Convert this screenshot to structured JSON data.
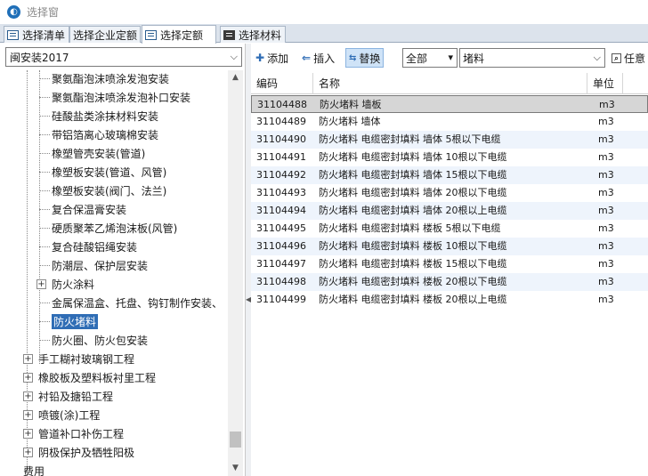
{
  "window": {
    "title": "选择窗"
  },
  "tabs": [
    {
      "label": "选择清单"
    },
    {
      "label": "选择企业定额"
    },
    {
      "label": "选择定额"
    },
    {
      "label": "选择材料"
    }
  ],
  "left": {
    "combo_value": "闽安装2017",
    "tree": [
      {
        "label": "聚氨酯泡沫喷涂发泡安装"
      },
      {
        "label": "聚氨酯泡沫喷涂发泡补口安装"
      },
      {
        "label": "硅酸盐类涂抹材料安装"
      },
      {
        "label": "带铝箔离心玻璃棉安装"
      },
      {
        "label": "橡塑管壳安装(管道)"
      },
      {
        "label": "橡塑板安装(管道、风管)"
      },
      {
        "label": "橡塑板安装(阀门、法兰)"
      },
      {
        "label": "复合保温膏安装"
      },
      {
        "label": "硬质聚苯乙烯泡沫板(风管)"
      },
      {
        "label": "复合硅酸铝绳安装"
      },
      {
        "label": "防潮层、保护层安装"
      },
      {
        "label": "防火涂料"
      },
      {
        "label": "金属保温盒、托盘、钩钉制作安装、"
      },
      {
        "label": "防火堵料"
      },
      {
        "label": "防火圈、防火包安装"
      },
      {
        "label": "手工糊衬玻璃钢工程"
      },
      {
        "label": "橡胶板及塑料板衬里工程"
      },
      {
        "label": "衬铅及搪铅工程"
      },
      {
        "label": "喷镀(涂)工程"
      },
      {
        "label": "管道补口补伤工程"
      },
      {
        "label": "阴极保护及牺牲阳极"
      },
      {
        "label": "费用"
      }
    ]
  },
  "toolbar": {
    "add_label": "添加",
    "insert_label": "插入",
    "replace_label": "替换",
    "scope_value": "全部",
    "search_value": "堵料",
    "any_label": "任意"
  },
  "grid": {
    "headers": {
      "code": "编码",
      "name": "名称",
      "unit": "单位"
    },
    "rows": [
      {
        "code": "31104488",
        "name": "防火堵料 墙板",
        "unit": "m3"
      },
      {
        "code": "31104489",
        "name": "防火堵料 墙体",
        "unit": "m3"
      },
      {
        "code": "31104490",
        "name": "防火堵料 电缆密封填料 墙体 5根以下电缆",
        "unit": "m3"
      },
      {
        "code": "31104491",
        "name": "防火堵料 电缆密封填料 墙体 10根以下电缆",
        "unit": "m3"
      },
      {
        "code": "31104492",
        "name": "防火堵料 电缆密封填料 墙体 15根以下电缆",
        "unit": "m3"
      },
      {
        "code": "31104493",
        "name": "防火堵料 电缆密封填料 墙体 20根以下电缆",
        "unit": "m3"
      },
      {
        "code": "31104494",
        "name": "防火堵料 电缆密封填料 墙体 20根以上电缆",
        "unit": "m3"
      },
      {
        "code": "31104495",
        "name": "防火堵料 电缆密封填料 楼板 5根以下电缆",
        "unit": "m3"
      },
      {
        "code": "31104496",
        "name": "防火堵料 电缆密封填料 楼板 10根以下电缆",
        "unit": "m3"
      },
      {
        "code": "31104497",
        "name": "防火堵料 电缆密封填料 楼板 15根以下电缆",
        "unit": "m3"
      },
      {
        "code": "31104498",
        "name": "防火堵料 电缆密封填料 楼板 20根以下电缆",
        "unit": "m3"
      },
      {
        "code": "31104499",
        "name": "防火堵料 电缆密封填料 楼板 20根以上电缆",
        "unit": "m3"
      }
    ]
  }
}
